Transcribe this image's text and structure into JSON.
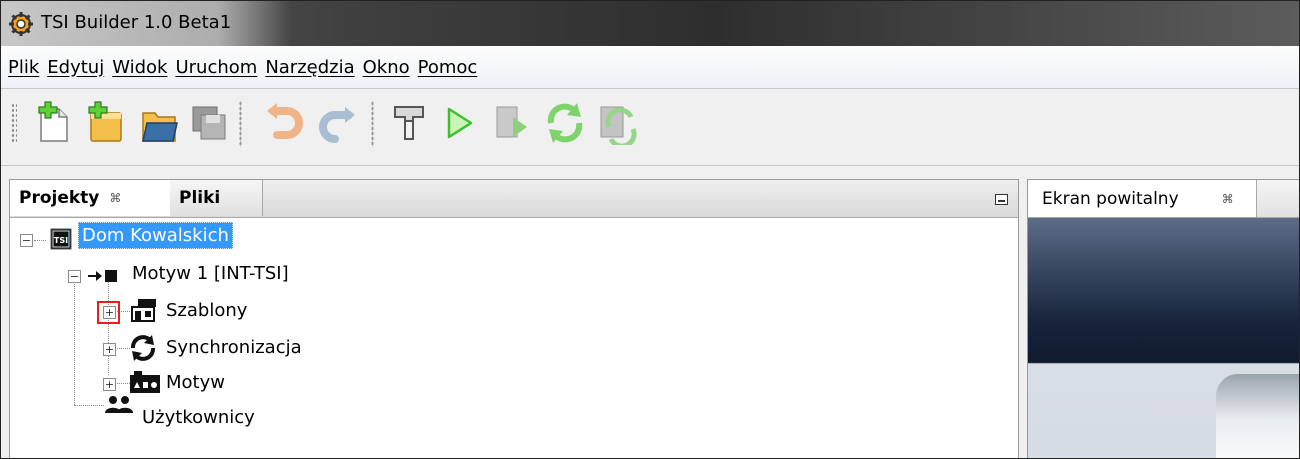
{
  "window": {
    "title": "TSI Builder 1.0 Beta1"
  },
  "menu": {
    "items": [
      {
        "label": "Plik"
      },
      {
        "label": "Edytuj"
      },
      {
        "label": "Widok"
      },
      {
        "label": "Uruchom"
      },
      {
        "label": "Narzędzia"
      },
      {
        "label": "Okno"
      },
      {
        "label": "Pomoc"
      }
    ]
  },
  "toolbar": {
    "buttons": [
      {
        "icon": "new-file-icon",
        "enabled": true
      },
      {
        "icon": "new-project-icon",
        "enabled": true
      },
      {
        "icon": "open-project-icon",
        "enabled": true
      },
      {
        "icon": "save-all-icon",
        "enabled": false
      },
      {
        "icon": "undo-icon",
        "enabled": false
      },
      {
        "icon": "redo-icon",
        "enabled": false
      },
      {
        "icon": "build-hammer-icon",
        "enabled": true
      },
      {
        "icon": "run-icon",
        "enabled": true
      },
      {
        "icon": "deploy-icon",
        "enabled": false
      },
      {
        "icon": "sync-icon",
        "enabled": true
      },
      {
        "icon": "sync-all-icon",
        "enabled": false
      }
    ]
  },
  "projects_panel": {
    "tabs": [
      {
        "label": "Projekty",
        "close": "⌘",
        "active": true
      },
      {
        "label": "Pliki",
        "active": false
      }
    ],
    "tree": {
      "root": {
        "badge": "TSI",
        "label": "Dom Kowalskich",
        "selected": true
      },
      "theme": {
        "label": "Motyw 1 [INT-TSI]"
      },
      "children": [
        {
          "label": "Szablony",
          "icon": "templates-icon"
        },
        {
          "label": "Synchronizacja",
          "icon": "sync-icon"
        },
        {
          "label": "Motyw",
          "icon": "theme-icon"
        }
      ],
      "users": {
        "label": "Użytkownicy",
        "icon": "users-icon"
      }
    }
  },
  "welcome_panel": {
    "tab": {
      "label": "Ekran powitalny",
      "close": "⌘"
    }
  },
  "colors": {
    "selection": "#3399ff",
    "highlight_box": "#e51e1e",
    "run_green": "#3fbf2f"
  }
}
